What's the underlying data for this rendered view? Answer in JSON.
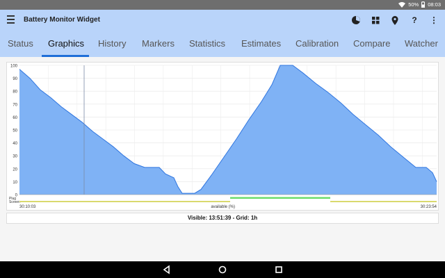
{
  "status_bar": {
    "battery": "50%",
    "time": "08:03",
    "icons": [
      "wifi-icon",
      "battery-icon"
    ]
  },
  "app_bar": {
    "title": "Battery Monitor Widget",
    "actions": [
      "donut-chart-icon",
      "grid-icon",
      "location-pin-icon",
      "help-icon",
      "more-vert-icon"
    ],
    "help_label": "?",
    "more_label": "⋮"
  },
  "tabs": [
    {
      "label": "Status"
    },
    {
      "label": "Graphics",
      "active": true
    },
    {
      "label": "History"
    },
    {
      "label": "Markers"
    },
    {
      "label": "Statistics"
    },
    {
      "label": "Estimates"
    },
    {
      "label": "Calibration"
    },
    {
      "label": "Compare"
    },
    {
      "label": "Watcher"
    }
  ],
  "chart_data": {
    "type": "area",
    "ylim": [
      0,
      100
    ],
    "yticks": [
      "0",
      "10",
      "20",
      "30",
      "40",
      "50",
      "60",
      "70",
      "80",
      "90",
      "100"
    ],
    "x_start_label": "30:10:03",
    "x_end_label": "30:23:54",
    "x_center_label": "available (%)",
    "row_labels": [
      "Plug",
      "Screen"
    ],
    "grid": true,
    "fill_color": "#7fb2f5",
    "line_color": "#2f75df",
    "plug_color": "#6cdc6c",
    "screen_color": "#d9d96e",
    "points": [
      [
        0,
        97
      ],
      [
        0.5,
        90
      ],
      [
        1,
        81
      ],
      [
        1.5,
        75
      ],
      [
        2,
        68
      ],
      [
        2.5,
        62
      ],
      [
        3,
        56
      ],
      [
        3.5,
        49
      ],
      [
        4,
        43
      ],
      [
        4.5,
        37
      ],
      [
        5,
        30
      ],
      [
        5.5,
        24
      ],
      [
        6,
        21
      ],
      [
        6.7,
        21
      ],
      [
        7,
        16
      ],
      [
        7.4,
        13
      ],
      [
        7.6,
        6
      ],
      [
        7.8,
        1
      ],
      [
        8.4,
        1
      ],
      [
        8.7,
        4
      ],
      [
        9.2,
        15
      ],
      [
        9.8,
        29
      ],
      [
        10.4,
        43
      ],
      [
        11,
        58
      ],
      [
        11.6,
        72
      ],
      [
        12.1,
        85
      ],
      [
        12.5,
        100
      ],
      [
        13.1,
        100
      ],
      [
        13.6,
        94
      ],
      [
        14.2,
        86
      ],
      [
        14.8,
        79
      ],
      [
        15.4,
        71
      ],
      [
        16,
        62
      ],
      [
        16.6,
        54
      ],
      [
        17.2,
        46
      ],
      [
        17.8,
        37
      ],
      [
        18.4,
        29
      ],
      [
        19,
        21
      ],
      [
        19.5,
        21
      ],
      [
        19.8,
        17
      ],
      [
        20,
        10
      ]
    ],
    "x_max": 20,
    "marker_x": 3.1,
    "plug_segments": [
      [
        10.1,
        14.9
      ]
    ],
    "screen_segments": [
      [
        0,
        10.1
      ],
      [
        14.9,
        20
      ]
    ]
  },
  "info": {
    "text": "Visible: 13:51:39 - Grid: 1h"
  },
  "nav_bar": {
    "buttons": [
      "back-icon",
      "home-icon",
      "recents-icon"
    ]
  }
}
